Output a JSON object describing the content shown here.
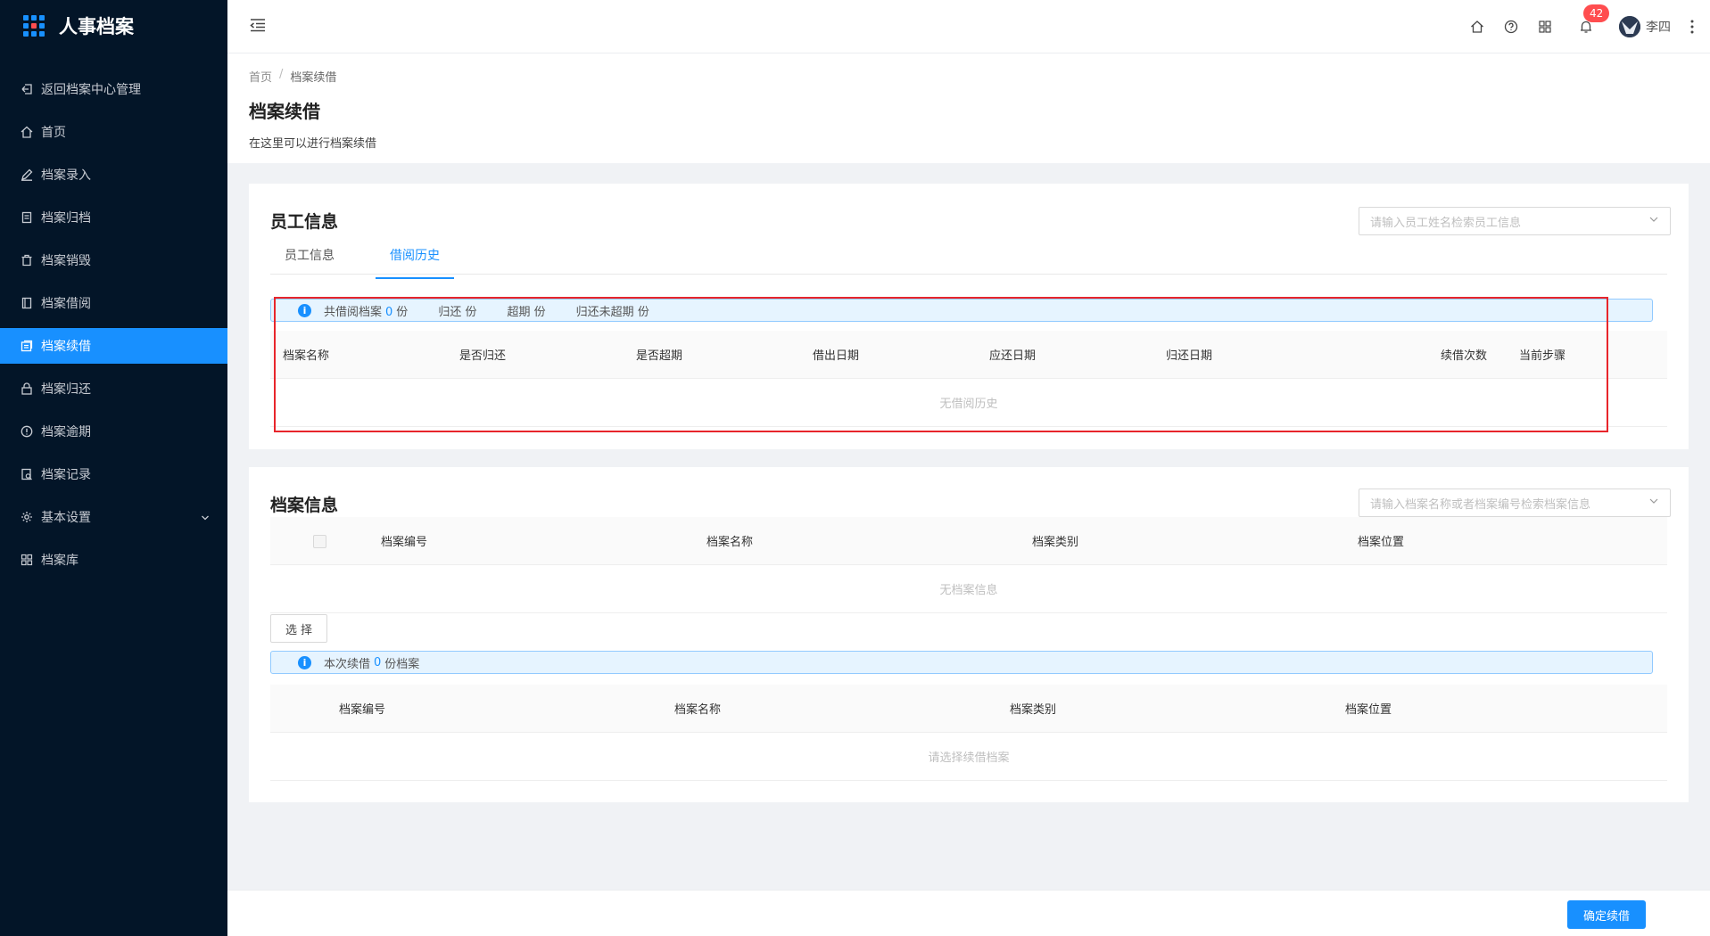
{
  "app": {
    "title": "人事档案"
  },
  "sidebar": {
    "items": [
      {
        "label": "返回档案中心管理",
        "icon": "return-icon"
      },
      {
        "label": "首页",
        "icon": "home-icon"
      },
      {
        "label": "档案录入",
        "icon": "edit-icon"
      },
      {
        "label": "档案归档",
        "icon": "archive-icon"
      },
      {
        "label": "档案销毁",
        "icon": "trash-icon"
      },
      {
        "label": "档案借阅",
        "icon": "book-icon"
      },
      {
        "label": "档案续借",
        "icon": "renew-icon",
        "active": true
      },
      {
        "label": "档案归还",
        "icon": "lock-icon"
      },
      {
        "label": "档案逾期",
        "icon": "warning-icon"
      },
      {
        "label": "档案记录",
        "icon": "record-icon"
      },
      {
        "label": "基本设置",
        "icon": "gear-icon",
        "expandable": true
      },
      {
        "label": "档案库",
        "icon": "grid-icon"
      }
    ]
  },
  "header": {
    "notification_count": "42",
    "username": "李四"
  },
  "page": {
    "breadcrumb_home": "首页",
    "breadcrumb_sep": "/",
    "breadcrumb_current": "档案续借",
    "title": "档案续借",
    "description": "在这里可以进行档案续借"
  },
  "employee_card": {
    "title": "员工信息",
    "search_placeholder": "请输入员工姓名检索员工信息",
    "tabs": [
      {
        "label": "员工信息",
        "active": false
      },
      {
        "label": "借阅历史",
        "active": true
      }
    ],
    "summary": {
      "total_prefix": "共借阅档案",
      "total_count": "0",
      "unit": "份",
      "returned_label": "归还",
      "overdue_label": "超期",
      "unreturned_label": "归还未超期"
    },
    "table": {
      "columns": [
        "档案名称",
        "是否归还",
        "是否超期",
        "借出日期",
        "应还日期",
        "归还日期",
        "续借次数",
        "当前步骤"
      ],
      "empty_text": "无借阅历史"
    }
  },
  "archive_card": {
    "title": "档案信息",
    "search_placeholder": "请输入档案名称或者档案编号检索档案信息",
    "table": {
      "columns": [
        "档案编号",
        "档案名称",
        "档案类别",
        "档案位置"
      ],
      "empty_text": "无档案信息"
    },
    "select_button": "选择",
    "renew_summary": {
      "prefix": "本次续借",
      "count": "0",
      "suffix": "份档案"
    },
    "renew_table": {
      "columns": [
        "档案编号",
        "档案名称",
        "档案类别",
        "档案位置"
      ],
      "empty_text": "请选择续借档案"
    }
  },
  "footer": {
    "confirm_button": "确定续借"
  },
  "colors": {
    "primary": "#1890ff",
    "sidebar_bg": "#031528",
    "highlight": "#e8252b",
    "badge": "#ff4d4f"
  }
}
